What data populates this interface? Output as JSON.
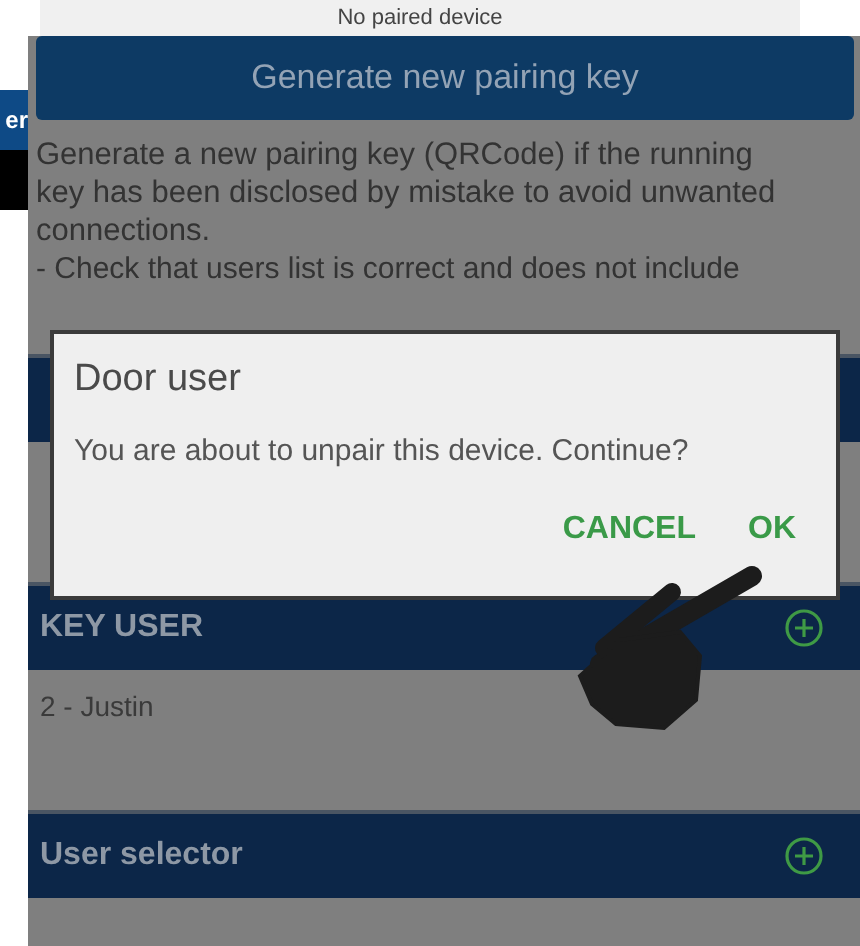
{
  "top_strip": {
    "text": "No paired device"
  },
  "side_fragment": {
    "text": "er"
  },
  "generate_button": {
    "label": "Generate new pairing key"
  },
  "description": "Generate a new pairing key (QRCode) if the running key has been disclosed by mistake to avoid unwanted connections.",
  "note": "- Check that users list is correct and does not include",
  "dialog": {
    "title": "Door user",
    "message": "You are about to unpair this device. Continue?",
    "buttons": [
      "CANCEL",
      "OK"
    ]
  },
  "sections": [
    {
      "title": "KEY USER",
      "rows": [
        "2 - Justin"
      ]
    },
    {
      "title": "User selector"
    }
  ]
}
